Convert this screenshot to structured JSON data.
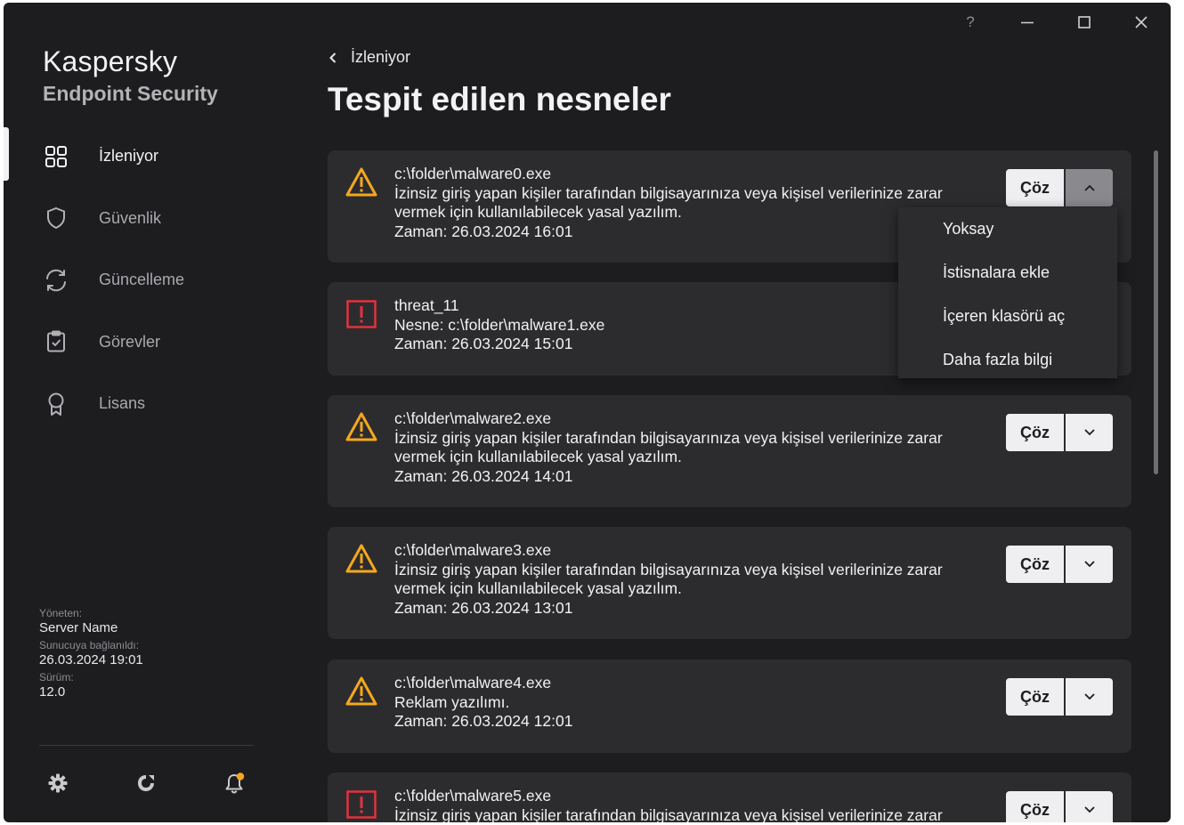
{
  "window": {
    "help_label": "?",
    "controls": [
      "minimize-icon",
      "maximize-icon",
      "close-icon"
    ]
  },
  "brand": {
    "name": "Kaspersky",
    "product": "Endpoint Security"
  },
  "nav": [
    {
      "label": "İzleniyor",
      "icon": "dashboard-icon",
      "active": true
    },
    {
      "label": "Güvenlik",
      "icon": "shield-icon",
      "active": false
    },
    {
      "label": "Güncelleme",
      "icon": "refresh-icon",
      "active": false
    },
    {
      "label": "Görevler",
      "icon": "clipboard-check-icon",
      "active": false
    },
    {
      "label": "Lisans",
      "icon": "ribbon-icon",
      "active": false
    }
  ],
  "meta": {
    "managed_by_label": "Yöneten:",
    "managed_by_value": "Server Name",
    "connected_label": "Sunucuya bağlanıldı:",
    "connected_value": "26.03.2024 19:01",
    "version_label": "Sürüm:",
    "version_value": "12.0"
  },
  "footer_icons": [
    "settings-icon",
    "support-icon",
    "notifications-icon"
  ],
  "colors": {
    "warning": "#f5a81c",
    "danger": "#e2323f",
    "notify_dot": "#f5a81c"
  },
  "breadcrumb": {
    "back_label": "İzleniyor"
  },
  "page_title": "Tespit edilen nesneler",
  "resolve_label": "Çöz",
  "detections": [
    {
      "severity": "warning",
      "lines": [
        "c:\\folder\\malware0.exe",
        "İzinsiz giriş yapan kişiler tarafından bilgisayarınıza veya kişisel verilerinize zarar",
        "vermek için kullanılabilecek yasal yazılım.",
        "Zaman: 26.03.2024 16:01"
      ],
      "expanded": true
    },
    {
      "severity": "danger",
      "lines": [
        "threat_11",
        "Nesne: c:\\folder\\malware1.exe",
        "Zaman: 26.03.2024 15:01"
      ],
      "expanded": false
    },
    {
      "severity": "warning",
      "lines": [
        "c:\\folder\\malware2.exe",
        "İzinsiz giriş yapan kişiler tarafından bilgisayarınıza veya kişisel verilerinize zarar",
        "vermek için kullanılabilecek yasal yazılım.",
        "Zaman: 26.03.2024 14:01"
      ],
      "expanded": false
    },
    {
      "severity": "warning",
      "lines": [
        "c:\\folder\\malware3.exe",
        "İzinsiz giriş yapan kişiler tarafından bilgisayarınıza veya kişisel verilerinize zarar",
        "vermek için kullanılabilecek yasal yazılım.",
        "Zaman: 26.03.2024 13:01"
      ],
      "expanded": false
    },
    {
      "severity": "warning",
      "lines": [
        "c:\\folder\\malware4.exe",
        "Reklam yazılımı.",
        "Zaman: 26.03.2024 12:01"
      ],
      "expanded": false
    },
    {
      "severity": "danger",
      "lines": [
        "c:\\folder\\malware5.exe",
        "İzinsiz giriş yapan kişiler tarafından bilgisayarınıza veya kişisel verilerinize zarar"
      ],
      "expanded": false
    }
  ],
  "dropdown_menu": [
    "Yoksay",
    "İstisnalara ekle",
    "İçeren klasörü aç",
    "Daha fazla bilgi"
  ]
}
